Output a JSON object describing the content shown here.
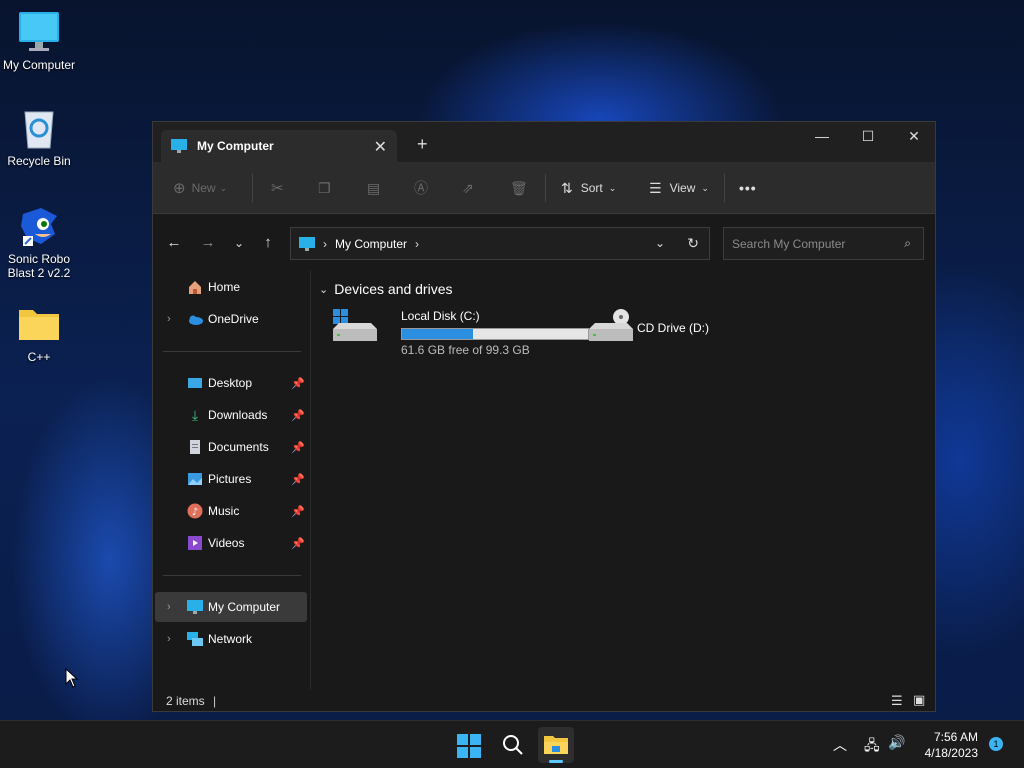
{
  "desktop": {
    "icons": [
      {
        "label": "My Computer"
      },
      {
        "label": "Recycle Bin"
      },
      {
        "label": "Sonic Robo Blast 2 v2.2"
      },
      {
        "label": "C++"
      }
    ]
  },
  "window": {
    "tab_title": "My Computer",
    "toolbar": {
      "new_label": "New",
      "sort_label": "Sort",
      "view_label": "View"
    },
    "address": {
      "location": "My Computer"
    },
    "search": {
      "placeholder": "Search My Computer"
    },
    "sidebar": {
      "items": [
        {
          "label": "Home"
        },
        {
          "label": "OneDrive"
        },
        {
          "label": "Desktop"
        },
        {
          "label": "Downloads"
        },
        {
          "label": "Documents"
        },
        {
          "label": "Pictures"
        },
        {
          "label": "Music"
        },
        {
          "label": "Videos"
        },
        {
          "label": "My Computer"
        },
        {
          "label": "Network"
        }
      ]
    },
    "content": {
      "group_title": "Devices and drives",
      "drives": [
        {
          "name": "Local Disk (C:)",
          "free_text": "61.6 GB free of 99.3 GB",
          "used_fraction": 0.38
        },
        {
          "name": "CD Drive (D:)"
        }
      ]
    },
    "status": {
      "item_count": "2 items"
    }
  },
  "taskbar": {
    "time": "7:56 AM",
    "date": "4/18/2023",
    "notification_count": "1"
  },
  "colors": {
    "accent": "#2b8ee0",
    "window_bg": "#191919",
    "toolbar_bg": "#2c2c2c"
  }
}
